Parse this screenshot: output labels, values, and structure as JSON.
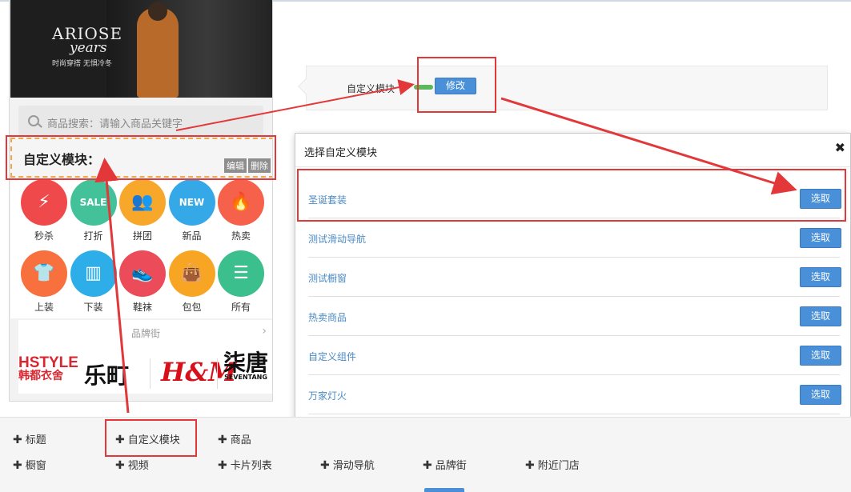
{
  "banner": {
    "brand": "ARIOSE",
    "brand_sub": "years",
    "slogan": "时尚穿搭 无惧冷冬"
  },
  "search": {
    "placeholder": "商品搜索：请输入商品关键字"
  },
  "custom_module": {
    "title": "自定义模块：",
    "edit": "编辑",
    "delete": "删除"
  },
  "icons": [
    {
      "label": "秒杀",
      "color": "#f0494b",
      "glyph": "⚡",
      "icon": "lightning-icon"
    },
    {
      "label": "打折",
      "color": "#43c29a",
      "glyph": "SALE",
      "icon": "sale-tag-icon"
    },
    {
      "label": "拼团",
      "color": "#f7a72a",
      "glyph": "👥",
      "icon": "group-icon"
    },
    {
      "label": "新品",
      "color": "#35a9e8",
      "glyph": "NEW",
      "icon": "new-badge-icon"
    },
    {
      "label": "热卖",
      "color": "#f5614a",
      "glyph": "🔥",
      "icon": "fire-icon"
    },
    {
      "label": "上装",
      "color": "#f7703e",
      "glyph": "👕",
      "icon": "shirt-icon"
    },
    {
      "label": "下装",
      "color": "#2eaee8",
      "glyph": "▥",
      "icon": "pants-icon"
    },
    {
      "label": "鞋袜",
      "color": "#ec4c5a",
      "glyph": "👟",
      "icon": "shoe-icon"
    },
    {
      "label": "包包",
      "color": "#f9a524",
      "glyph": "👜",
      "icon": "bag-icon"
    },
    {
      "label": "所有",
      "color": "#3bbf8c",
      "glyph": "☰",
      "icon": "menu-icon"
    }
  ],
  "brands": {
    "title": "品牌街",
    "logos": [
      {
        "text": "HSTYLE",
        "sub": "韩都衣舍",
        "color": "#d9262f"
      },
      {
        "text": "乐町",
        "color": "#111"
      },
      {
        "text": "H&M",
        "color": "#d8101a"
      },
      {
        "text": "柒唐",
        "sub": "SEVENTANG",
        "color": "#111"
      }
    ]
  },
  "module_row": {
    "label": "自定义模块",
    "modify": "修改"
  },
  "dialog": {
    "title": "选择自定义模块",
    "close": "✖",
    "pick_label": "选取",
    "options": [
      "圣诞套装",
      "测试滑动导航",
      "测试橱窗",
      "热卖商品",
      "自定义组件",
      "万家灯火"
    ]
  },
  "toolbar": {
    "items": [
      "标题",
      "自定义模块",
      "商品",
      "橱窗",
      "视频",
      "卡片列表",
      "滑动导航",
      "品牌街",
      "附近门店"
    ],
    "plus": "✚"
  },
  "colors": {
    "highlight": "#e2383a",
    "primary": "#4a90d9",
    "dashed": "#f0a64a"
  }
}
